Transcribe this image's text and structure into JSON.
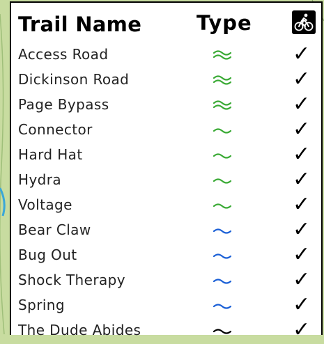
{
  "header": {
    "trail_name_label": "Trail Name",
    "type_label": "Type",
    "bike_icon": "mountain-bike-icon"
  },
  "legend_colors": {
    "easy": "#3aaa35",
    "intermediate": "#1a5fd6",
    "difficult": "#000000"
  },
  "trails": [
    {
      "name": "Access Road",
      "type": "double-green",
      "bike": "✓"
    },
    {
      "name": "Dickinson Road",
      "type": "double-green",
      "bike": "✓"
    },
    {
      "name": "Page Bypass",
      "type": "double-green",
      "bike": "✓"
    },
    {
      "name": "Connector",
      "type": "single-green",
      "bike": "✓"
    },
    {
      "name": "Hard Hat",
      "type": "single-green",
      "bike": "✓"
    },
    {
      "name": "Hydra",
      "type": "single-green",
      "bike": "✓"
    },
    {
      "name": "Voltage",
      "type": "single-green",
      "bike": "✓"
    },
    {
      "name": "Bear Claw",
      "type": "single-blue",
      "bike": "✓"
    },
    {
      "name": "Bug Out",
      "type": "single-blue",
      "bike": "✓"
    },
    {
      "name": "Shock Therapy",
      "type": "single-blue",
      "bike": "✓"
    },
    {
      "name": "Spring",
      "type": "single-blue",
      "bike": "✓"
    },
    {
      "name": "The Dude Abides",
      "type": "single-black",
      "bike": "✓"
    }
  ]
}
